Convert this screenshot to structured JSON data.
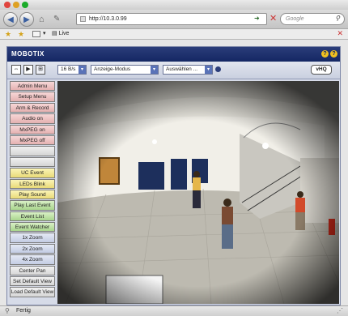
{
  "browser": {
    "url": "http://10.3.0.99",
    "search_placeholder": "Google",
    "bookmark_label": "Live",
    "status_text": "Fertig"
  },
  "app": {
    "logo": "MOBOTIX",
    "help_icon_1": "?",
    "help_icon_2": "?",
    "toolbar": {
      "fps": "16 B/s",
      "mode": "Anzeige-Modus",
      "select": "Auswählen ...",
      "quality": "vHQ"
    },
    "menu": [
      {
        "label": "Admin Menu",
        "color": "red"
      },
      {
        "label": "Setup Menu",
        "color": "red"
      },
      {
        "label": "Arm & Record",
        "color": "red"
      },
      {
        "label": "Audio on",
        "color": "red"
      },
      {
        "label": "MxPEG on",
        "color": "red"
      },
      {
        "label": "MxPEG off",
        "color": "red"
      },
      {
        "label": "",
        "color": "blank"
      },
      {
        "label": "",
        "color": "blank"
      },
      {
        "label": "UC Event",
        "color": "yellow"
      },
      {
        "label": "LEDs Blink",
        "color": "yellow"
      },
      {
        "label": "Play Sound",
        "color": "yellow"
      },
      {
        "label": "Play Last Event",
        "color": "green"
      },
      {
        "label": "Event List",
        "color": "green"
      },
      {
        "label": "Event Watcher",
        "color": "green"
      },
      {
        "label": "1x Zoom",
        "color": "blue"
      },
      {
        "label": "2x Zoom",
        "color": "blue"
      },
      {
        "label": "4x Zoom",
        "color": "blue"
      },
      {
        "label": "Center Pan",
        "color": "gray"
      },
      {
        "label": "Set Default View",
        "color": "gray"
      },
      {
        "label": "Load Default View",
        "color": "gray"
      }
    ]
  }
}
